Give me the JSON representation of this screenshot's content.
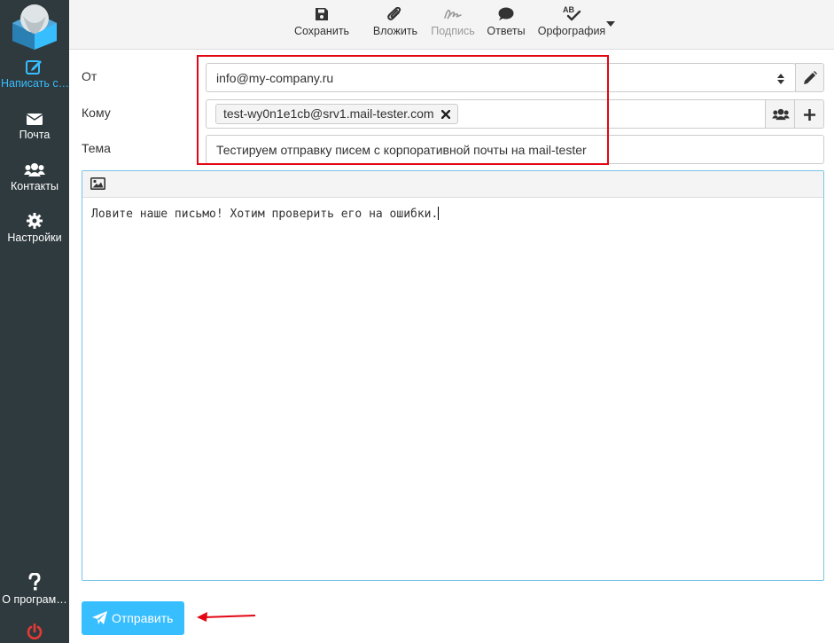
{
  "sidebar": {
    "items": [
      {
        "label": "Написать с…",
        "icon": "edit-icon",
        "active": true
      },
      {
        "label": "Почта",
        "icon": "envelope-icon"
      },
      {
        "label": "Контакты",
        "icon": "users-icon"
      },
      {
        "label": "Настройки",
        "icon": "gear-icon"
      },
      {
        "label": "О програм…",
        "icon": "question-icon"
      }
    ]
  },
  "toolbar": {
    "save": "Сохранить",
    "attach": "Вложить",
    "signature": "Подпись",
    "responses": "Ответы",
    "spell": "Орфография"
  },
  "form": {
    "from_label": "От",
    "from_value": "info@my-company.ru",
    "to_label": "Кому",
    "to_recipient": "test-wy0n1e1cb@srv1.mail-tester.com",
    "subject_label": "Тема",
    "subject_value": "Тестируем отправку писем с корпоративной почты на mail-tester"
  },
  "editor": {
    "body": "Ловите наше письмо! Хотим проверить его на ошибки."
  },
  "send_label": "Отправить",
  "colors": {
    "accent": "#37beff",
    "sidebar_bg": "#2f3a3f",
    "annotation": "#e30613"
  }
}
